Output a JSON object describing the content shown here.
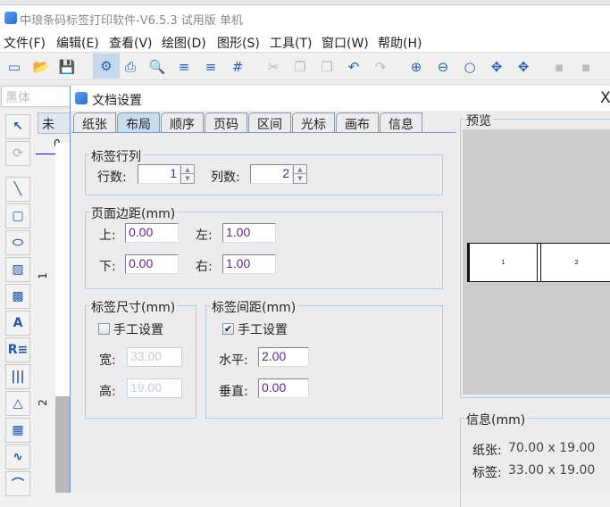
{
  "app": {
    "title": "中琅条码标签打印软件-V6.5.3 试用版 单机"
  },
  "menu": [
    "文件(F)",
    "编辑(E)",
    "查看(V)",
    "绘图(D)",
    "图形(S)",
    "工具(T)",
    "窗口(W)",
    "帮助(H)"
  ],
  "toolbar": [
    {
      "icon": "new-document-icon",
      "glyph": "▭"
    },
    {
      "icon": "open-folder-icon",
      "glyph": "📂"
    },
    {
      "icon": "save-icon",
      "glyph": "💾"
    },
    {
      "icon": "document-settings-gear-icon",
      "glyph": "⚙"
    },
    {
      "icon": "print-icon",
      "glyph": "⎙"
    },
    {
      "icon": "print-preview-icon",
      "glyph": "🔍"
    },
    {
      "icon": "database-icon",
      "glyph": "≡"
    },
    {
      "icon": "database-settings-icon",
      "glyph": "≡"
    },
    {
      "icon": "grid-icon",
      "glyph": "#"
    },
    {
      "icon": "cut-icon",
      "glyph": "✂"
    },
    {
      "icon": "copy-icon",
      "glyph": "❐"
    },
    {
      "icon": "paste-icon",
      "glyph": "❐"
    },
    {
      "icon": "undo-icon",
      "glyph": "↶"
    },
    {
      "icon": "redo-icon",
      "glyph": "↷"
    },
    {
      "icon": "zoom-in-icon",
      "glyph": "⊕"
    },
    {
      "icon": "zoom-out-icon",
      "glyph": "⊖"
    },
    {
      "icon": "zoom-icon",
      "glyph": "○"
    },
    {
      "icon": "fit-page-icon",
      "glyph": "✥"
    },
    {
      "icon": "actual-size-icon",
      "glyph": "✥"
    },
    {
      "icon": "align-icon",
      "glyph": "▪"
    },
    {
      "icon": "align-icon-2",
      "glyph": "▪"
    }
  ],
  "font": {
    "value": "黑体"
  },
  "tools": [
    {
      "icon": "pointer-icon",
      "glyph": "↖"
    },
    {
      "icon": "rotate-icon",
      "glyph": "⟳"
    },
    {
      "icon": "line-icon",
      "glyph": "╲"
    },
    {
      "icon": "rounded-rectangle-icon",
      "glyph": "▢"
    },
    {
      "icon": "ellipse-icon",
      "glyph": "⬭"
    },
    {
      "icon": "image-icon",
      "glyph": "▨"
    },
    {
      "icon": "picture-icon",
      "glyph": "▩"
    },
    {
      "icon": "text-icon",
      "glyph": "A"
    },
    {
      "icon": "rich-text-icon",
      "glyph": "R≡"
    },
    {
      "icon": "barcode-icon",
      "glyph": "|||"
    },
    {
      "icon": "triangle-shape-icon",
      "glyph": "△"
    },
    {
      "icon": "qrcode-icon",
      "glyph": "▦"
    },
    {
      "icon": "curve-icon",
      "glyph": "∿"
    },
    {
      "icon": "arc-icon",
      "glyph": "⌒"
    }
  ],
  "doc_tab": {
    "label": "未"
  },
  "ruler": {
    "top": "0",
    "marks": [
      "1",
      "2"
    ]
  },
  "dialog": {
    "title": "文档设置",
    "close": "X",
    "tabs": [
      "纸张",
      "布局",
      "顺序",
      "页码",
      "区间",
      "光标",
      "画布",
      "信息"
    ],
    "active_tab": "布局",
    "rowcol": {
      "legend": "标签行列",
      "rows_label": "行数:",
      "rows": "1",
      "cols_label": "列数:",
      "cols": "2"
    },
    "margins": {
      "legend": "页面边距(mm)",
      "top_label": "上:",
      "top": "0.00",
      "left_label": "左:",
      "left": "1.00",
      "bottom_label": "下:",
      "bottom": "0.00",
      "right_label": "右:",
      "right": "1.00"
    },
    "size": {
      "legend": "标签尺寸(mm)",
      "manual": "手工设置",
      "manual_checked": false,
      "width_label": "宽:",
      "width": "33.00",
      "height_label": "高:",
      "height": "19.00"
    },
    "gap": {
      "legend": "标签间距(mm)",
      "manual": "手工设置",
      "manual_checked": true,
      "h_label": "水平:",
      "h": "2.00",
      "v_label": "垂直:",
      "v": "0.00"
    },
    "preview": {
      "legend": "预览",
      "cells": [
        "1",
        "2"
      ]
    },
    "info": {
      "legend": "信息(mm)",
      "paper_label": "纸张:",
      "paper": "70.00 x 19.00",
      "label_label": "标签:",
      "label": "33.00 x 19.00"
    }
  }
}
